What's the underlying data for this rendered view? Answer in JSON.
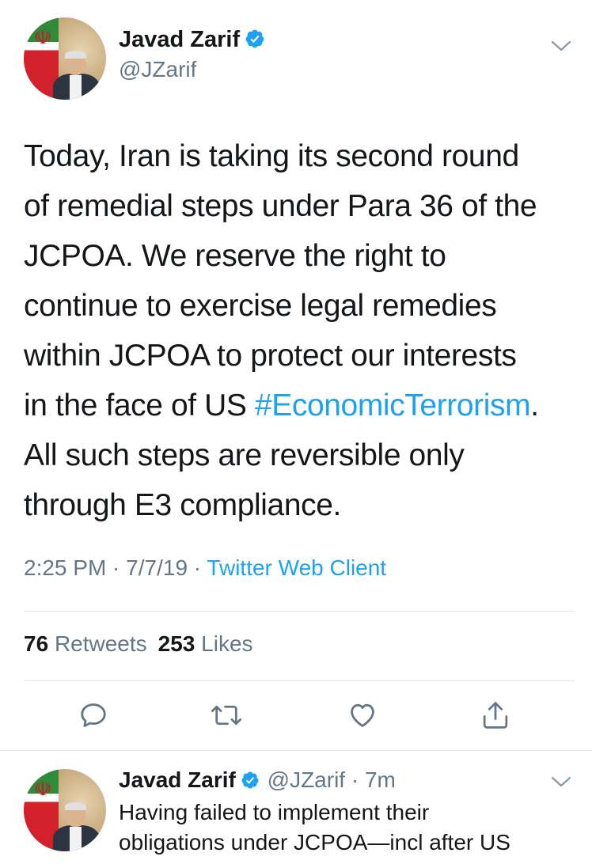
{
  "tweet": {
    "display_name": "Javad Zarif",
    "handle": "@JZarif",
    "text_lines": [
      "Today, Iran is taking its second round",
      "of remedial steps under Para 36 of the",
      "JCPOA. We reserve the right to",
      "continue to exercise legal remedies",
      "within JCPOA to protect our interests",
      "in the face of US ",
      "All such steps are reversible only",
      "through E3 compliance."
    ],
    "hashtag": "#EconomicTerrorism",
    "hashtag_suffix": ".",
    "time": "2:25 PM",
    "date": "7/7/19",
    "client": "Twitter Web Client",
    "meta_separator": " · ",
    "retweets_count": "76",
    "retweets_label": "Retweets",
    "likes_count": "253",
    "likes_label": "Likes"
  },
  "actions": {
    "reply_icon": "reply-icon",
    "retweet_icon": "retweet-icon",
    "like_icon": "like-icon",
    "share_icon": "share-icon"
  },
  "reply_tweet": {
    "display_name": "Javad Zarif",
    "handle_time": "@JZarif · 7m",
    "text_lines": [
      "Having failed to implement their",
      "obligations under JCPOA—incl after US"
    ]
  },
  "colors": {
    "link": "#1da1f2",
    "secondary_text": "#657786",
    "primary_text": "#14171a",
    "divider": "#e1e8ed"
  }
}
